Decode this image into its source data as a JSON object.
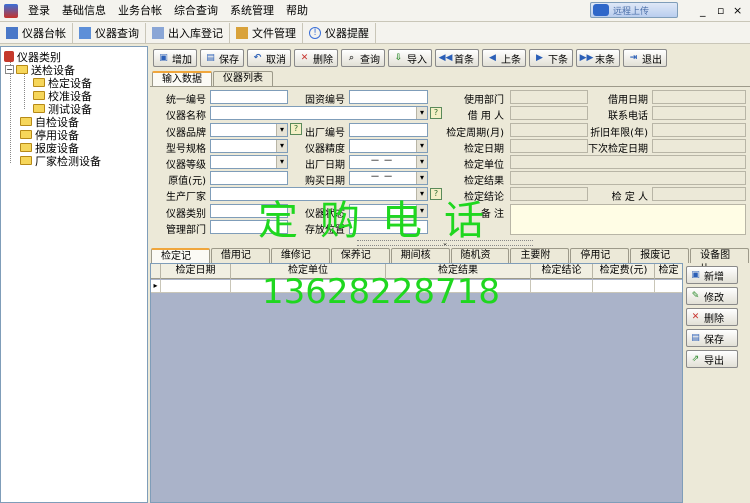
{
  "menu": {
    "items": [
      "登录",
      "基础信息",
      "业务台帐",
      "综合查询",
      "系统管理",
      "帮助"
    ],
    "upload_label": "远程上传",
    "min_symbol": "_",
    "restore_symbol": "▫",
    "close_symbol": "×"
  },
  "modules": [
    {
      "label": "仪器台帐",
      "icon": "ledger-icon"
    },
    {
      "label": "仪器查询",
      "icon": "query-icon"
    },
    {
      "label": "出入库登记",
      "icon": "register-icon"
    },
    {
      "label": "文件管理",
      "icon": "files-icon"
    },
    {
      "label": "仪器提醒",
      "icon": "reminder-icon"
    }
  ],
  "tree": {
    "root": "仪器类别",
    "nodes": [
      {
        "label": "送检设备",
        "level": 1,
        "expanded": true
      },
      {
        "label": "检定设备",
        "level": 2
      },
      {
        "label": "校准设备",
        "level": 2
      },
      {
        "label": "测试设备",
        "level": 2
      },
      {
        "label": "自检设备",
        "level": 1
      },
      {
        "label": "停用设备",
        "level": 1
      },
      {
        "label": "报废设备",
        "level": 1
      },
      {
        "label": "厂家检测设备",
        "level": 1
      }
    ]
  },
  "toolbar": {
    "add": "增加",
    "save": "保存",
    "cancel": "取消",
    "delete": "删除",
    "query": "查询",
    "import": "导入",
    "first": "首条",
    "prev": "上条",
    "next": "下条",
    "last": "末条",
    "exit": "退出"
  },
  "upper_tabs": {
    "entry": "输入数据",
    "list": "仪器列表"
  },
  "form": {
    "labels": {
      "unified_no": "统一编号",
      "asset_no": "固资编号",
      "dept": "使用部门",
      "borrow_date": "借用日期",
      "name": "仪器名称",
      "borrower": "借  用  人",
      "phone": "联系电话",
      "brand": "仪器品牌",
      "factory_no": "出厂编号",
      "cycle": "检定周期(月)",
      "depreciation": "折旧年限(年)",
      "model": "型号规格",
      "precision": "仪器精度",
      "cal_date": "检定日期",
      "next_cal": "下次检定日期",
      "grade": "仪器等级",
      "factory_date": "出厂日期",
      "cal_unit": "检定单位",
      "price": "原值(元)",
      "purchase_date": "购买日期",
      "cal_result": "检定结果",
      "maker": "生产厂家",
      "cal_conclusion": "检定结论",
      "inspector": "检  定  人",
      "category": "仪器类别",
      "status": "仪器状态",
      "remark": "备    注",
      "manage_dept": "管理部门",
      "location": "存放位置"
    },
    "values": {
      "factory_date": "－  －",
      "purchase_date": "－  －"
    }
  },
  "watermark": {
    "text": "定购电话",
    "phone": "13628228718"
  },
  "lower_tabs": [
    "检定记录",
    "借用记录",
    "维修记录",
    "保养记录",
    "期间核查",
    "随机资料",
    "主要附件",
    "停用记录",
    "报废记录",
    "设备图片"
  ],
  "grid": {
    "columns": [
      "检定日期",
      "检定单位",
      "检定结果",
      "检定结论",
      "检定费(元)",
      "检定"
    ],
    "row_marker": "▸"
  },
  "side_buttons": {
    "add": "新增",
    "edit": "修改",
    "delete": "删除",
    "save": "保存",
    "export": "导出"
  },
  "colors": {
    "watermark": "#1fd71f",
    "tab_accent": "#f0a63c",
    "grid_bg": "#aab3c9"
  }
}
